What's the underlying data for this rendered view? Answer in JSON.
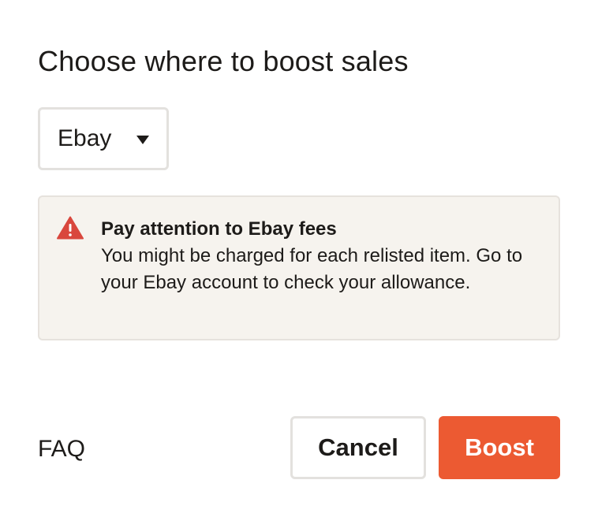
{
  "dialog": {
    "title": "Choose where to boost sales",
    "platform_select": {
      "selected": "Ebay"
    },
    "notice": {
      "icon": "warning-triangle-icon",
      "title": "Pay attention to Ebay fees",
      "text": "You might be charged for each relisted item. Go to your Ebay account to check your allowance.",
      "icon_color": "#d9473d",
      "background": "#f6f3ee"
    },
    "footer": {
      "faq_label": "FAQ",
      "cancel_label": "Cancel",
      "boost_label": "Boost"
    },
    "colors": {
      "accent": "#ec5a32",
      "text": "#1d1b19"
    }
  }
}
